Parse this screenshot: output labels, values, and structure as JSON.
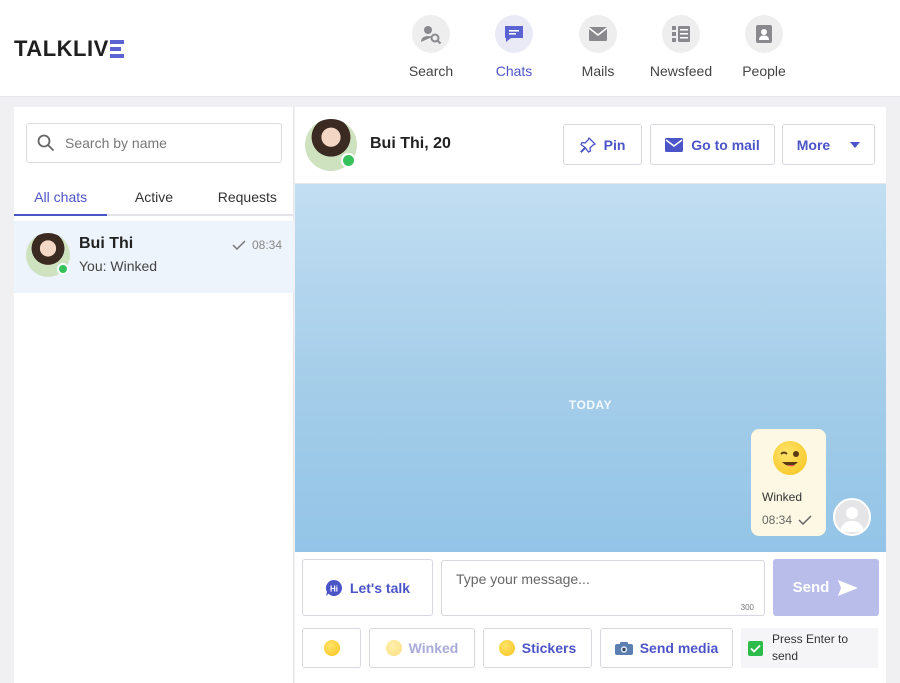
{
  "brand": {
    "logo_text": "TALKLIV",
    "logo_suffix_icon": "e-bars-icon",
    "accent": "#4c55c8"
  },
  "nav": [
    {
      "label": "Search",
      "icon": "search-user-icon"
    },
    {
      "label": "Chats",
      "icon": "chat-bubble-icon",
      "active": true
    },
    {
      "label": "Mails",
      "icon": "envelope-icon"
    },
    {
      "label": "Newsfeed",
      "icon": "newsfeed-icon"
    },
    {
      "label": "People",
      "icon": "person-icon"
    }
  ],
  "sidebar": {
    "search_placeholder": "Search by name",
    "tabs": [
      "All chats",
      "Active",
      "Requests"
    ],
    "active_tab": "All chats",
    "chats": [
      {
        "name": "Bui Thi",
        "preview": "You:  Winked",
        "time": "08:34",
        "online": true,
        "read": true
      }
    ]
  },
  "conversation": {
    "title": "Bui Thi, 20",
    "online": true,
    "buttons": {
      "pin": "Pin",
      "mail": "Go to mail",
      "more": "More"
    },
    "day_divider": "TODAY",
    "messages": [
      {
        "type": "wink",
        "text": "Winked",
        "time": "08:34",
        "read": true,
        "from_me": true
      }
    ]
  },
  "composer": {
    "lets_talk": "Let's talk",
    "placeholder": "Type your message...",
    "char_limit": "300",
    "send": "Send",
    "emoji_icon": "smiley-icon",
    "winked": "Winked",
    "stickers": "Stickers",
    "send_media": "Send media",
    "press_enter": "Press Enter to send",
    "press_enter_checked": true
  }
}
